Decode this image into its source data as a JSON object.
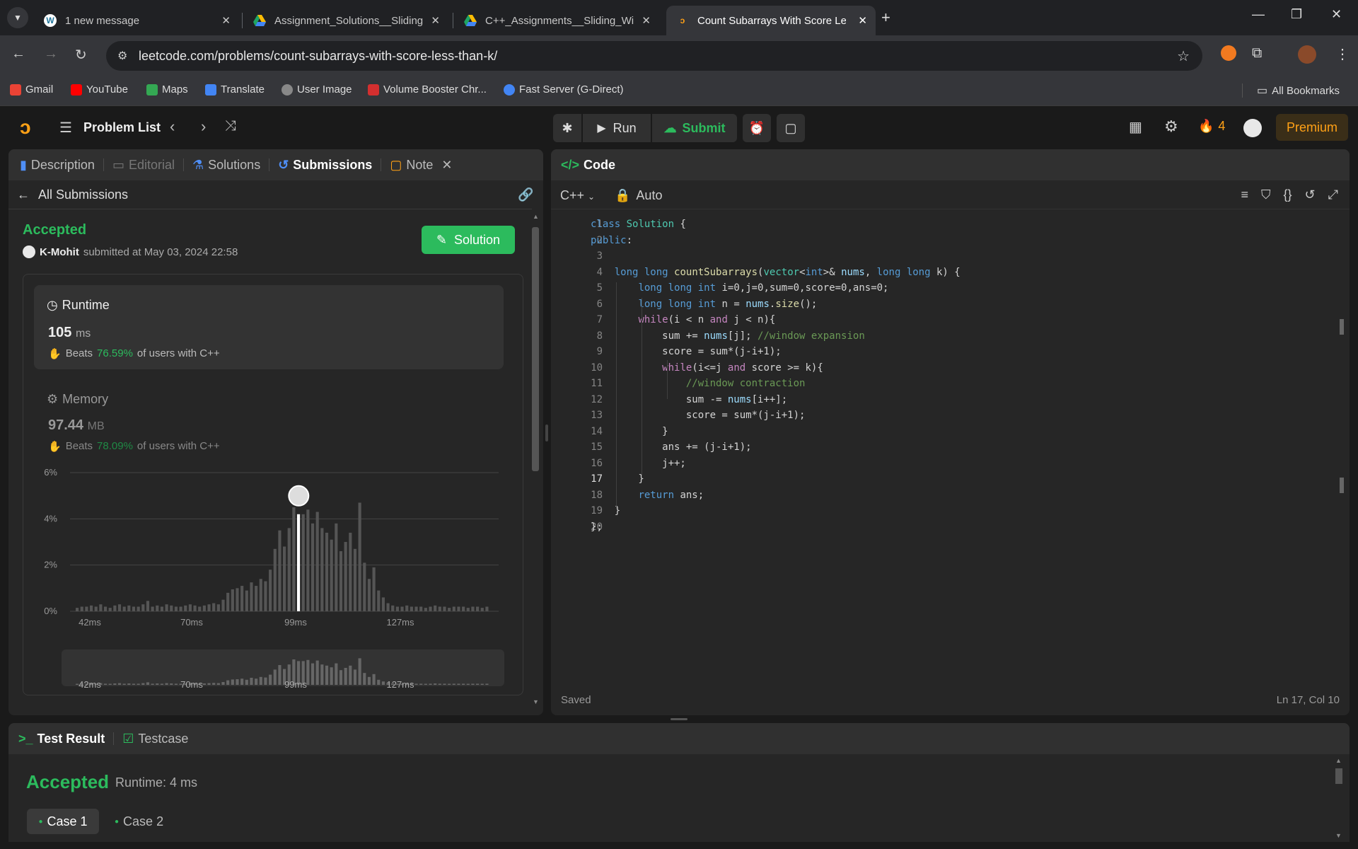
{
  "browser": {
    "tabs": [
      {
        "title": "1 new message",
        "icon": "wordpress-icon"
      },
      {
        "title": "Assignment_Solutions__Sliding",
        "icon": "google-drive-icon"
      },
      {
        "title": "C++_Assignments__Sliding_Wi",
        "icon": "google-drive-icon"
      },
      {
        "title": "Count Subarrays With Score Les",
        "icon": "leetcode-icon",
        "active": true
      }
    ],
    "url": "leetcode.com/problems/count-subarrays-with-score-less-than-k/",
    "bookmarks": [
      "Gmail",
      "YouTube",
      "Maps",
      "Translate",
      "User Image",
      "Volume Booster Chr...",
      "Fast Server (G-Direct)"
    ],
    "all_bookmarks": "All Bookmarks"
  },
  "header": {
    "problem_list": "Problem List",
    "run": "Run",
    "submit": "Submit",
    "streak": "4",
    "premium": "Premium"
  },
  "left": {
    "tabs": [
      "Description",
      "Editorial",
      "Solutions",
      "Submissions",
      "Note"
    ],
    "all_submissions": "All Submissions",
    "status": "Accepted",
    "user": "K-Mohit",
    "submitted_text": "submitted at May 03, 2024 22:58",
    "solution_btn": "Solution",
    "runtime": {
      "label": "Runtime",
      "value": "105",
      "unit": "ms",
      "beats_pre": "Beats",
      "beats_pct": "76.59%",
      "beats_post": "of users with C++"
    },
    "memory": {
      "label": "Memory",
      "value": "97.44",
      "unit": "MB",
      "beats_pre": "Beats",
      "beats_pct": "78.09%",
      "beats_post": "of users with C++"
    }
  },
  "chart_data": {
    "type": "bar",
    "ylabels": [
      "6%",
      "4%",
      "2%",
      "0%"
    ],
    "xlabels": [
      "42ms",
      "70ms",
      "99ms",
      "127ms"
    ],
    "ylim": [
      0,
      6
    ],
    "values": [
      0.15,
      0.2,
      0.2,
      0.25,
      0.2,
      0.3,
      0.2,
      0.15,
      0.25,
      0.3,
      0.2,
      0.25,
      0.2,
      0.2,
      0.3,
      0.45,
      0.2,
      0.25,
      0.2,
      0.3,
      0.25,
      0.2,
      0.2,
      0.25,
      0.3,
      0.25,
      0.2,
      0.25,
      0.3,
      0.35,
      0.3,
      0.5,
      0.8,
      0.95,
      1.0,
      1.1,
      0.9,
      1.25,
      1.1,
      1.4,
      1.3,
      1.8,
      2.7,
      3.5,
      2.8,
      3.6,
      4.5,
      4.2,
      4.2,
      4.4,
      3.8,
      4.3,
      3.6,
      3.4,
      3.1,
      3.8,
      2.6,
      3.0,
      3.4,
      2.7,
      4.7,
      2.1,
      1.4,
      1.9,
      0.9,
      0.6,
      0.35,
      0.25,
      0.2,
      0.2,
      0.25,
      0.2,
      0.2,
      0.2,
      0.15,
      0.2,
      0.25,
      0.2,
      0.2,
      0.15,
      0.2,
      0.2,
      0.2,
      0.15,
      0.2,
      0.2,
      0.15,
      0.2
    ],
    "highlight_index": 47
  },
  "editor": {
    "title": "Code",
    "lang": "C++",
    "mode": "Auto",
    "status": "Saved",
    "cursor": "Ln 17, Col 10"
  },
  "code_lines": [
    "class Solution {",
    "public:",
    "",
    "    long long countSubarrays(vector<int>& nums, long long k) {",
    "        long long int i=0,j=0,sum=0,score=0,ans=0;",
    "        long long int n = nums.size();",
    "        while(i < n and j < n){",
    "            sum += nums[j]; //window expansion",
    "            score = sum*(j-i+1);",
    "            while(i<=j and score >= k){",
    "                //window contraction",
    "                sum -= nums[i++];",
    "                score = sum*(j-i+1);",
    "            }",
    "            ans += (j-i+1);",
    "            j++;",
    "        }",
    "        return ans;",
    "    }",
    "};"
  ],
  "bottom": {
    "tabs": [
      "Test Result",
      "Testcase"
    ],
    "status": "Accepted",
    "runtime": "Runtime: 4 ms",
    "cases": [
      "Case 1",
      "Case 2"
    ]
  },
  "colors": {
    "accent": "#2cbb5d",
    "orange": "#ffa116",
    "bg": "#1a1a1a",
    "panel": "#262626"
  }
}
